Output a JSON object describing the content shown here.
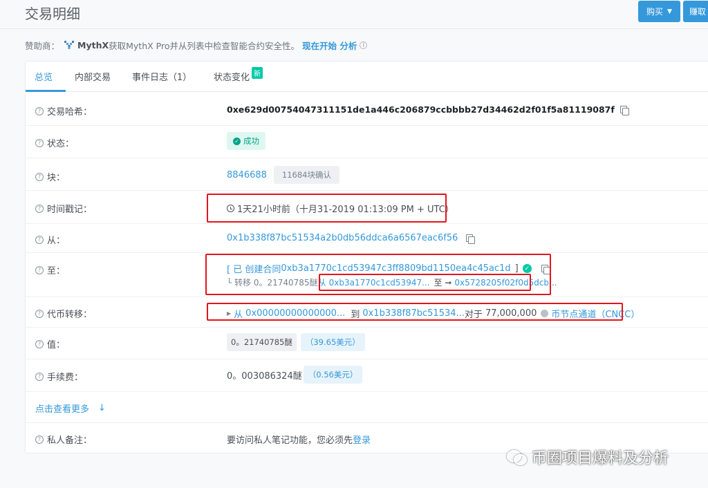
{
  "header": {
    "title": "交易明细",
    "buy_label": "购买",
    "earn_label": "赚取"
  },
  "sponsor": {
    "prefix": "赞助商：",
    "brand": "MythX",
    "text": "获取MythX Pro并从列表中检查智能合约安全性。",
    "cta": "现在开始 分析"
  },
  "tabs": [
    {
      "label": "总览"
    },
    {
      "label": "内部交易"
    },
    {
      "label": "事件日志（1）"
    },
    {
      "label": "状态变化",
      "badge": "新"
    }
  ],
  "rows": {
    "hash": {
      "label": "交易哈希：",
      "value": "0xe629d00754047311151de1a446c206879ccbbbb27d34462d2f01f5a81119087f"
    },
    "status": {
      "label": "状态：",
      "value": "成功"
    },
    "block": {
      "label": "块：",
      "value": "8846688",
      "confirmations": "11684块确认"
    },
    "timestamp": {
      "label": "时间戳记：",
      "value": "1天21小时前（十月31-2019 01:13:09 PM + UTC）"
    },
    "from": {
      "label": "从：",
      "value": "0x1b338f87bc51534a2b0db56ddca6a6567eac6f56"
    },
    "to": {
      "label": "至：",
      "prefix": "[ 已 创建合同",
      "contract": "0xb3a1770c1cd53947c3ff8809bd1150ea4c45ac1d",
      "suffix": "]",
      "transfer_prefix": "└ 转移 0。21740785醚",
      "transfer_from_label": "从",
      "transfer_from": "0xb3a1770c1cd53947...",
      "transfer_to_label": "至 ➞",
      "transfer_to": "0x5728205f02f0d5dcb..."
    },
    "token_transfer": {
      "label": "代币转移：",
      "from_label": "从",
      "from": "0x00000000000000...",
      "to_label": "到",
      "to": "0x1b338f87bc51534...",
      "amount_label": "对于",
      "amount": "77,000,000",
      "token": "币节点通道（CNCC）"
    },
    "value": {
      "label": "值：",
      "value": "0。21740785醚",
      "usd": "（39.65美元）"
    },
    "fee": {
      "label": "手续费：",
      "value": "0。003086324醚",
      "usd": "（0.56美元）"
    },
    "more": {
      "label": "点击查看更多",
      "arrow": "↓"
    },
    "note": {
      "label": "私人备注：",
      "text": "要访问私人笔记功能，您必须先",
      "link": "登录"
    }
  },
  "watermark": {
    "text": "币圈项目爆料及分析"
  },
  "colors": {
    "accent": "#3498db",
    "success": "#00a186",
    "annotation": "#e3141b"
  }
}
